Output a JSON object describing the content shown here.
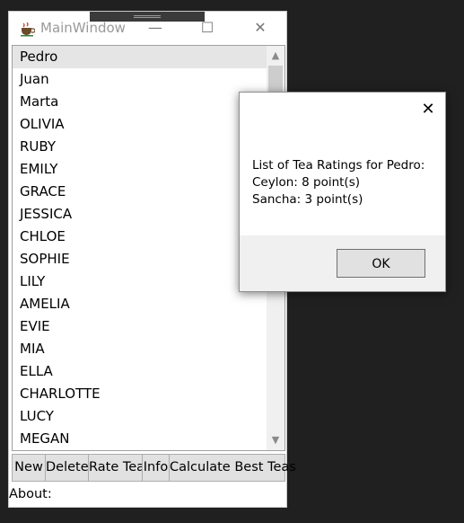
{
  "window": {
    "title": "MainWindow",
    "controls": {
      "minimize": "—",
      "maximize": "☐",
      "close": "✕"
    }
  },
  "list": {
    "items": [
      "Pedro",
      "Juan",
      "Marta",
      "OLIVIA",
      "RUBY",
      "EMILY",
      "GRACE",
      "JESSICA",
      "CHLOE",
      "SOPHIE",
      "LILY",
      "AMELIA",
      "EVIE",
      "MIA",
      "ELLA",
      "CHARLOTTE",
      "LUCY",
      "MEGAN"
    ],
    "selected": "Pedro"
  },
  "buttons": {
    "new": "New",
    "delete": "Delete",
    "rate_tea": "Rate Tea",
    "info": "Info",
    "calculate_best_teas": "Calculate Best Teas"
  },
  "about_label": "About:",
  "dialog": {
    "lines": [
      "List of Tea Ratings for Pedro:",
      "Ceylon: 8 point(s)",
      "Sancha: 3 point(s)"
    ],
    "ok": "OK",
    "close": "✕"
  },
  "icons": {
    "app": "teacup-icon",
    "scroll_up": "chevron-up-icon",
    "scroll_down": "chevron-down-icon"
  },
  "colors": {
    "desktop_background": "#202020",
    "selection": "#e5e5e5",
    "button_face": "#e1e1e1"
  }
}
